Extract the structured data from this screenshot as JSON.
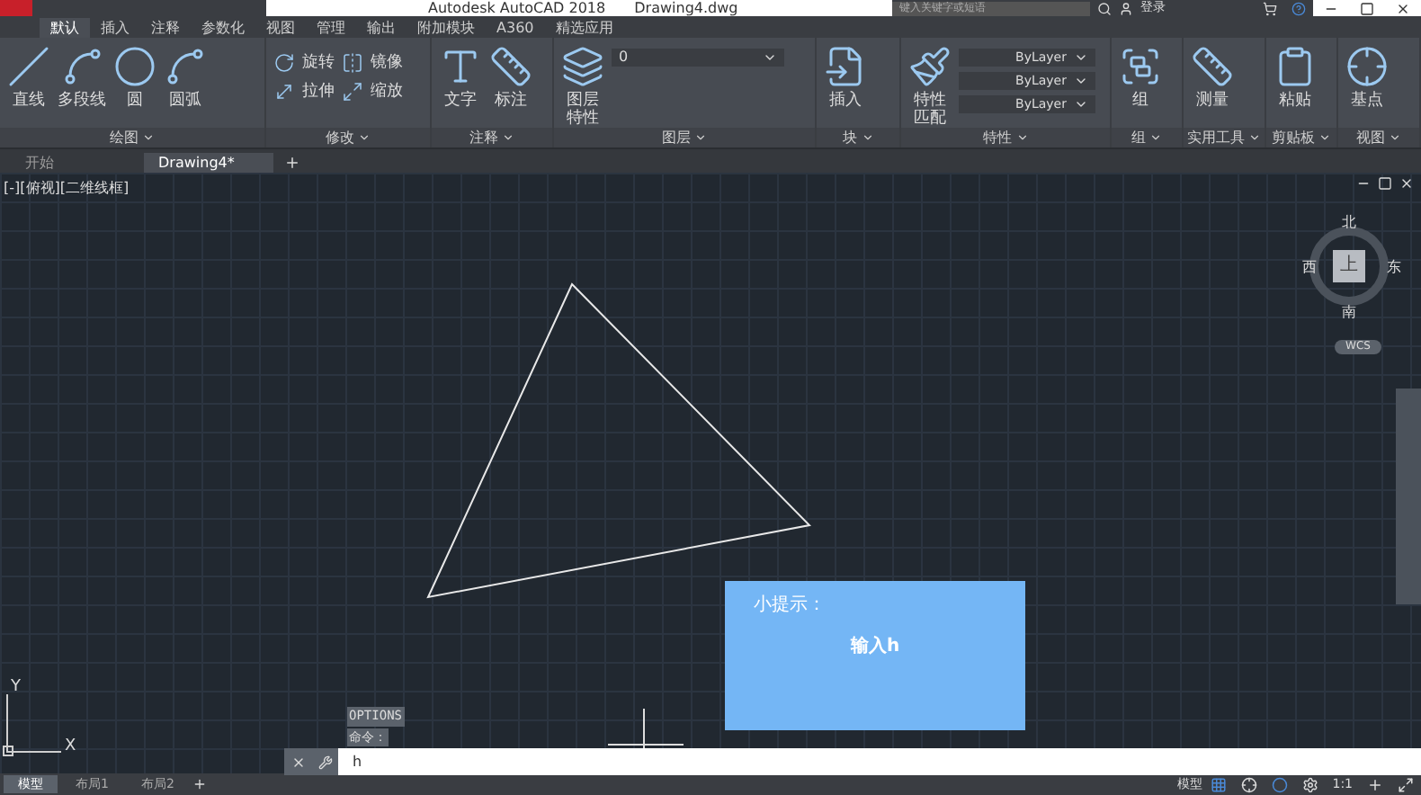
{
  "window": {
    "title": "Autodesk AutoCAD 2018",
    "file": "Drawing4.dwg",
    "search": {
      "placeholder": "键入关键字或短语"
    },
    "sign_in": "登录"
  },
  "ribbon_tabs": [
    {
      "label": "默认",
      "selected": true
    },
    {
      "label": "插入",
      "selected": false
    },
    {
      "label": "注释",
      "selected": false
    },
    {
      "label": "参数化",
      "selected": false
    },
    {
      "label": "视图",
      "selected": false
    },
    {
      "label": "管理",
      "selected": false
    },
    {
      "label": "输出",
      "selected": false
    },
    {
      "label": "附加模块",
      "selected": false
    },
    {
      "label": "A360",
      "selected": false
    },
    {
      "label": "精选应用",
      "selected": false
    }
  ],
  "ribbon_panels": [
    {
      "title": "绘图",
      "tools": [
        "直线",
        "多段线",
        "圆",
        "圆弧"
      ]
    },
    {
      "title": "修改",
      "tools": [
        "旋转",
        "镜像",
        "拉伸",
        "缩放"
      ]
    },
    {
      "title": "注释",
      "tools": [
        "文字",
        "标注"
      ]
    },
    {
      "title": "图层",
      "tools": [
        "图层特性"
      ],
      "layer": "0"
    },
    {
      "title": "块",
      "tools": [
        "插入"
      ]
    },
    {
      "title": "特性",
      "tools": [
        "特性匹配"
      ],
      "dropdowns": [
        "ByLayer",
        "ByLayer",
        "ByLayer"
      ]
    },
    {
      "title": "组",
      "tools": [
        "组"
      ]
    },
    {
      "title": "实用工具",
      "tools": [
        "测量"
      ]
    },
    {
      "title": "剪贴板",
      "tools": [
        "粘贴"
      ]
    },
    {
      "title": "视图",
      "tools": [
        "基点"
      ]
    }
  ],
  "file_tabs": [
    {
      "label": "开始",
      "selected": false
    },
    {
      "label": "Drawing4*",
      "selected": true
    }
  ],
  "viewport": {
    "label": "[-][俯视][二维线框]",
    "viewcube": {
      "north": "北",
      "west": "西",
      "top": "上",
      "east": "东",
      "south": "南",
      "ucs": "WCS"
    },
    "axes": {
      "x": "X",
      "y": "Y"
    }
  },
  "tip": {
    "title": "小提示：",
    "text": "输入h"
  },
  "command": {
    "history": [
      "OPTIONS",
      "命令："
    ],
    "value": "h"
  },
  "layout_tabs": [
    {
      "label": "模型",
      "selected": true
    },
    {
      "label": "布局1",
      "selected": false
    },
    {
      "label": "布局2",
      "selected": false
    }
  ],
  "status_bar": {
    "space": "模型",
    "scale": "1:1"
  }
}
